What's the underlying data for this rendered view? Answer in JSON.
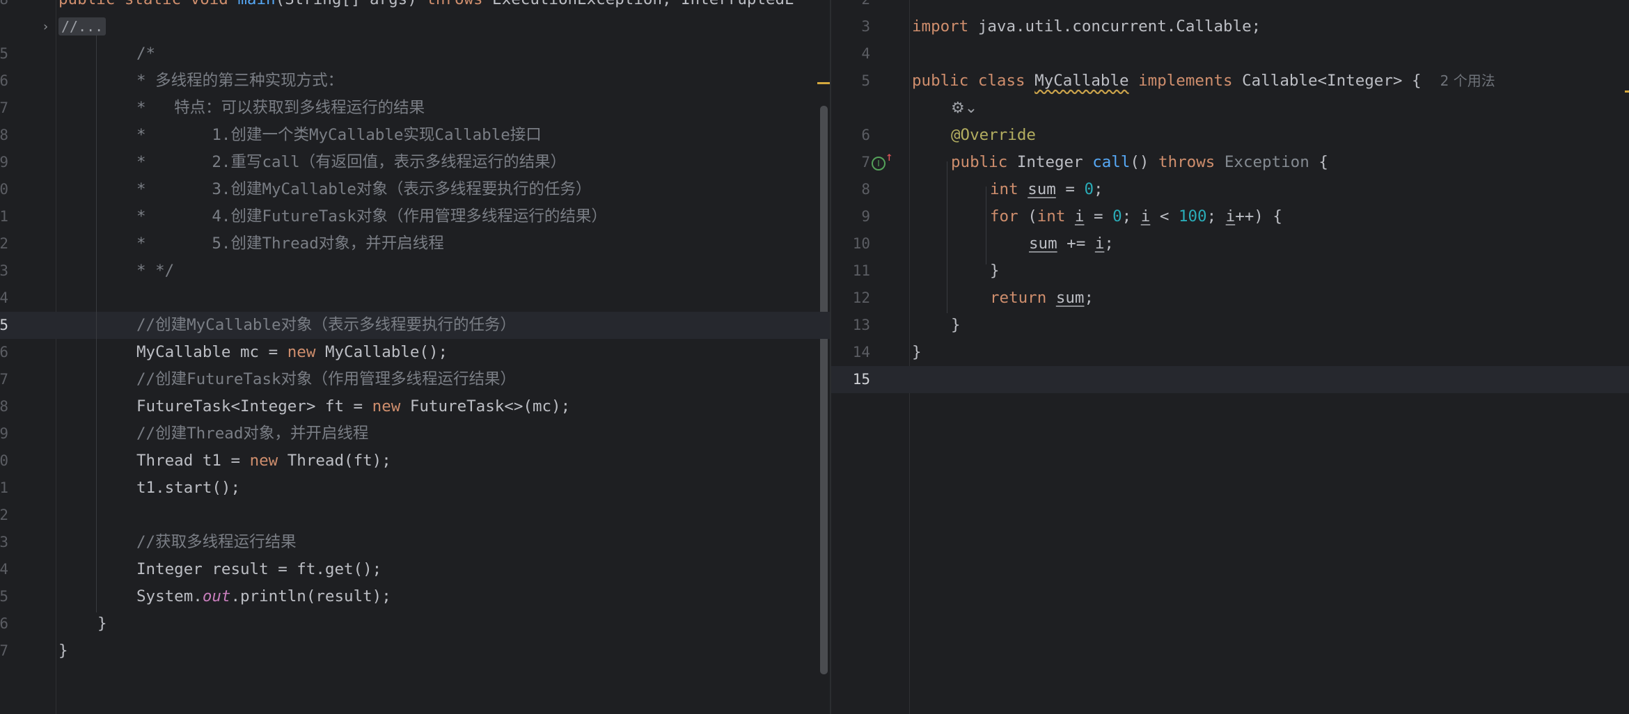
{
  "left_editor": {
    "lines": [
      {
        "num": "8",
        "tokens": [
          {
            "t": "public ",
            "c": "k"
          },
          {
            "t": "static ",
            "c": "k"
          },
          {
            "t": "void ",
            "c": "k"
          },
          {
            "t": "main",
            "c": "f"
          },
          {
            "t": "(String[] args) "
          },
          {
            "t": "throws ",
            "c": "k"
          },
          {
            "t": "ExecutionException, InterruptedE"
          }
        ]
      },
      {
        "num": "",
        "fold_label": "//...",
        "indent": 0
      },
      {
        "num": "5",
        "indent": 1,
        "tokens": [
          {
            "t": "/*",
            "c": "c"
          }
        ]
      },
      {
        "num": "6",
        "indent": 1,
        "tokens": [
          {
            "t": "* 多线程的第三种实现方式：",
            "c": "c"
          }
        ]
      },
      {
        "num": "7",
        "indent": 1,
        "tokens": [
          {
            "t": "*   特点：可以获取到多线程运行的结果",
            "c": "c"
          }
        ]
      },
      {
        "num": "8",
        "indent": 1,
        "tokens": [
          {
            "t": "*       1.创建一个类MyCallable实现Callable接口",
            "c": "c"
          }
        ]
      },
      {
        "num": "9",
        "indent": 1,
        "tokens": [
          {
            "t": "*       2.重写call（有返回值，表示多线程运行的结果）",
            "c": "c"
          }
        ]
      },
      {
        "num": "0",
        "indent": 1,
        "tokens": [
          {
            "t": "*       3.创建MyCallable对象（表示多线程要执行的任务）",
            "c": "c"
          }
        ]
      },
      {
        "num": "1",
        "indent": 1,
        "tokens": [
          {
            "t": "*       4.创建FutureTask对象（作用管理多线程运行的结果）",
            "c": "c"
          }
        ]
      },
      {
        "num": "2",
        "indent": 1,
        "tokens": [
          {
            "t": "*       5.创建Thread对象，并开启线程",
            "c": "c"
          }
        ]
      },
      {
        "num": "3",
        "indent": 1,
        "tokens": [
          {
            "t": "* */",
            "c": "c"
          }
        ]
      },
      {
        "num": "4",
        "tokens": []
      },
      {
        "num": "5",
        "indent": 1,
        "current": true,
        "tokens": [
          {
            "t": "//创建MyCallable对象（表示多线程要执行的任务）",
            "c": "c"
          }
        ]
      },
      {
        "num": "6",
        "indent": 1,
        "tokens": [
          {
            "t": "MyCallable mc = "
          },
          {
            "t": "new ",
            "c": "k"
          },
          {
            "t": "MyCallable();"
          }
        ]
      },
      {
        "num": "7",
        "indent": 1,
        "tokens": [
          {
            "t": "//创建FutureTask对象（作用管理多线程运行结果）",
            "c": "c"
          }
        ]
      },
      {
        "num": "8",
        "indent": 1,
        "tokens": [
          {
            "t": "FutureTask<Integer> ft = "
          },
          {
            "t": "new ",
            "c": "k"
          },
          {
            "t": "FutureTask<>(mc);"
          }
        ]
      },
      {
        "num": "9",
        "indent": 1,
        "tokens": [
          {
            "t": "//创建Thread对象，并开启线程",
            "c": "c"
          }
        ]
      },
      {
        "num": "0",
        "indent": 1,
        "tokens": [
          {
            "t": "Thread t1 = "
          },
          {
            "t": "new ",
            "c": "k"
          },
          {
            "t": "Thread(ft);"
          }
        ]
      },
      {
        "num": "1",
        "indent": 1,
        "tokens": [
          {
            "t": "t1.start();"
          }
        ]
      },
      {
        "num": "2",
        "tokens": []
      },
      {
        "num": "3",
        "indent": 1,
        "tokens": [
          {
            "t": "//获取多线程运行结果",
            "c": "c"
          }
        ]
      },
      {
        "num": "4",
        "indent": 1,
        "tokens": [
          {
            "t": "Integer result = ft.get();"
          }
        ]
      },
      {
        "num": "5",
        "indent": 1,
        "tokens": [
          {
            "t": "System."
          },
          {
            "t": "out",
            "c": "st"
          },
          {
            "t": ".println(result);"
          }
        ]
      },
      {
        "num": "6",
        "indent": 0.5,
        "tokens": [
          {
            "t": "}"
          }
        ]
      },
      {
        "num": "7",
        "indent": 0,
        "tokens": [
          {
            "t": "}"
          }
        ]
      }
    ]
  },
  "right_editor": {
    "lines": [
      {
        "num": "2",
        "tokens": []
      },
      {
        "num": "3",
        "tokens": [
          {
            "t": "import ",
            "c": "k"
          },
          {
            "t": "java.util.concurrent.Callable;"
          }
        ]
      },
      {
        "num": "4",
        "tokens": []
      },
      {
        "num": "5",
        "tokens": [
          {
            "t": "public ",
            "c": "k"
          },
          {
            "t": "class ",
            "c": "k"
          },
          {
            "t": "MyCallable",
            "c": "wavy"
          },
          {
            "t": " "
          },
          {
            "t": "implements ",
            "c": "k"
          },
          {
            "t": "Callable<Integer> {  "
          },
          {
            "t": "2 个用法",
            "c": "hint"
          }
        ]
      },
      {
        "num": "",
        "ai_icon": true,
        "tokens": []
      },
      {
        "num": "6",
        "indent": 1,
        "tokens": [
          {
            "t": "@Override",
            "c": "an"
          }
        ]
      },
      {
        "num": "7",
        "indent": 1,
        "impl": true,
        "tokens": [
          {
            "t": "public ",
            "c": "k"
          },
          {
            "t": "Integer "
          },
          {
            "t": "call",
            "c": "f"
          },
          {
            "t": "() "
          },
          {
            "t": "throws ",
            "c": "k"
          },
          {
            "t": "Exception",
            "c": "ex"
          },
          {
            "t": " {"
          }
        ]
      },
      {
        "num": "8",
        "indent": 2,
        "tokens": [
          {
            "t": "int ",
            "c": "k"
          },
          {
            "t": "sum",
            "c": "u"
          },
          {
            "t": " = "
          },
          {
            "t": "0",
            "c": "n"
          },
          {
            "t": ";"
          }
        ]
      },
      {
        "num": "9",
        "indent": 2,
        "tokens": [
          {
            "t": "for ",
            "c": "k"
          },
          {
            "t": "("
          },
          {
            "t": "int ",
            "c": "k"
          },
          {
            "t": "i",
            "c": "u"
          },
          {
            "t": " = "
          },
          {
            "t": "0",
            "c": "n"
          },
          {
            "t": "; "
          },
          {
            "t": "i",
            "c": "u"
          },
          {
            "t": " < "
          },
          {
            "t": "100",
            "c": "n"
          },
          {
            "t": "; "
          },
          {
            "t": "i",
            "c": "u"
          },
          {
            "t": "++) {"
          }
        ]
      },
      {
        "num": "10",
        "indent": 3,
        "tokens": [
          {
            "t": "sum",
            "c": "u"
          },
          {
            "t": " += "
          },
          {
            "t": "i",
            "c": "u"
          },
          {
            "t": ";"
          }
        ]
      },
      {
        "num": "11",
        "indent": 2,
        "tokens": [
          {
            "t": "}"
          }
        ]
      },
      {
        "num": "12",
        "indent": 2,
        "tokens": [
          {
            "t": "return ",
            "c": "k"
          },
          {
            "t": "sum",
            "c": "u"
          },
          {
            "t": ";"
          }
        ]
      },
      {
        "num": "13",
        "indent": 1,
        "tokens": [
          {
            "t": "}"
          }
        ]
      },
      {
        "num": "14",
        "indent": 0,
        "tokens": [
          {
            "t": "}"
          }
        ]
      },
      {
        "num": "15",
        "current": true,
        "tokens": []
      }
    ]
  },
  "icons": {
    "fold": "chevron-right-icon",
    "implements": "implements-gutter-icon",
    "ai": "ai-assistant-icon"
  },
  "colors": {
    "background": "#1e1f22",
    "keyword": "#cf8e6d",
    "function": "#56a8f5",
    "number": "#2aacb8",
    "comment": "#7a7e85",
    "annotation": "#b3ae60",
    "static_field": "#c77dbb"
  }
}
